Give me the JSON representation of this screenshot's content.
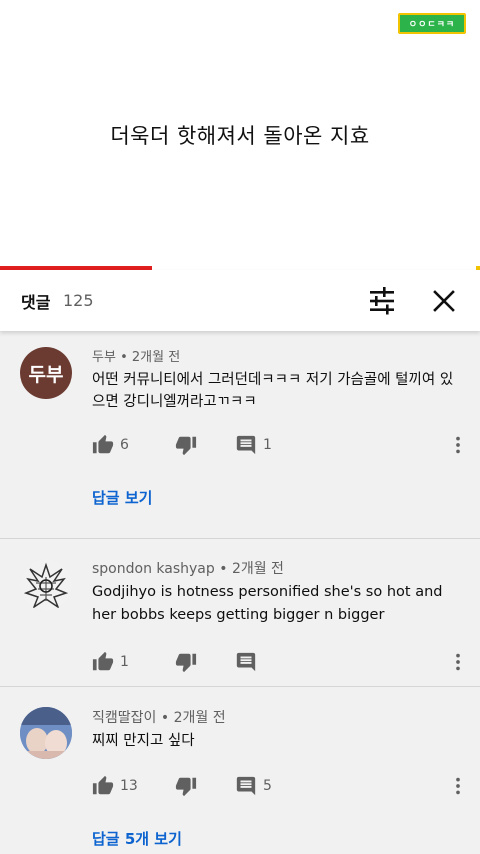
{
  "video": {
    "title": "더욱더 핫해져서 돌아온 지효",
    "channel_logo_text": "ㅇㅇㄷㅋㅋ",
    "progress_fraction": 0.317,
    "progress_color": "#e01f1f"
  },
  "comments_panel": {
    "title": "댓글",
    "count": "125"
  },
  "comments": [
    {
      "author": "두부",
      "separator": "•",
      "time": "2개월 전",
      "avatar_text": "두부",
      "avatar_color": "#6b3a30",
      "text": "어떤 커뮤니티에서 그러던데ㅋㅋㅋ 저기 가슴골에 털끼여 있으면 강디니엘꺼라고ㄲㅋㅋ",
      "likes": "6",
      "replies_count": "1",
      "view_replies": "답글 보기"
    },
    {
      "author": "spondon kashyap",
      "separator": "•",
      "time": "2개월 전",
      "avatar_text": "",
      "avatar_color": "#e8e8e8",
      "text": "Godjihyo is hotness personified she's so hot and her bobbs keeps getting bigger n bigger",
      "likes": "1",
      "replies_count": "",
      "view_replies": ""
    },
    {
      "author": "직캠딸잡이",
      "separator": "•",
      "time": "2개월 전",
      "avatar_text": "",
      "avatar_color": "#7a9ac8",
      "text": "찌찌 만지고 싶다",
      "likes": "13",
      "replies_count": "5",
      "view_replies": "답글 5개 보기"
    }
  ],
  "icons": {
    "sort": "tune-icon",
    "close": "close-icon",
    "like": "thumb-up-icon",
    "dislike": "thumb-down-icon",
    "reply": "comment-icon",
    "more": "more-vert-icon"
  }
}
